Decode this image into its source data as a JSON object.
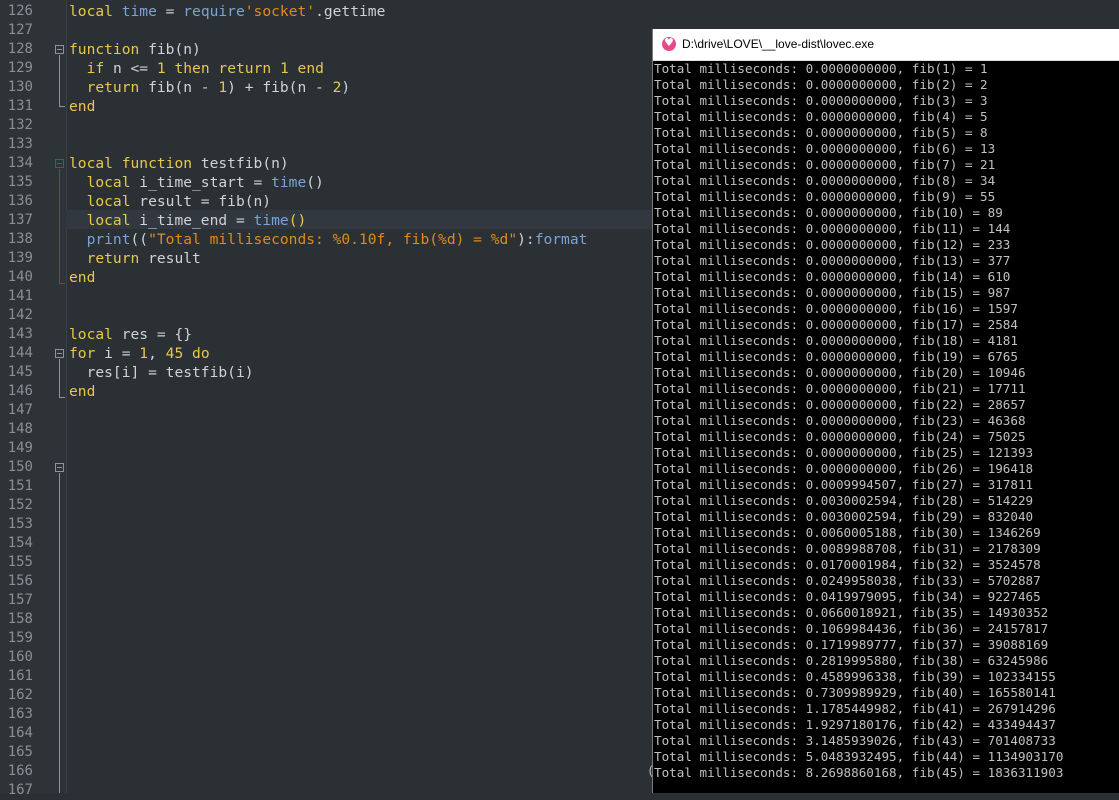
{
  "editor": {
    "line_numbers": [
      "126",
      "127",
      "128",
      "129",
      "130",
      "131",
      "132",
      "133",
      "134",
      "135",
      "136",
      "137",
      "138",
      "139",
      "140",
      "141",
      "142",
      "143",
      "144",
      "145",
      "146",
      "147",
      "148",
      "149",
      "150",
      "151",
      "152",
      "153",
      "154",
      "155",
      "156",
      "157",
      "158",
      "159",
      "160",
      "161",
      "162",
      "163",
      "164",
      "165",
      "166",
      "167"
    ],
    "lines": [
      [
        [
          "kw",
          "local"
        ],
        [
          "pl",
          " "
        ],
        [
          "bi",
          "time"
        ],
        [
          "pl",
          " = "
        ],
        [
          "bi",
          "require"
        ],
        [
          "str",
          "'socket'"
        ],
        [
          "pl",
          ".gettime"
        ]
      ],
      [],
      [
        [
          "kw",
          "function"
        ],
        [
          "pl",
          " fib(n)"
        ]
      ],
      [
        [
          "kw",
          "if"
        ],
        [
          "pl",
          " n <= "
        ],
        [
          "nm",
          "1"
        ],
        [
          "pl",
          " "
        ],
        [
          "kw",
          "then"
        ],
        [
          "pl",
          " "
        ],
        [
          "kw",
          "return"
        ],
        [
          "pl",
          " "
        ],
        [
          "nm",
          "1"
        ],
        [
          "pl",
          " "
        ],
        [
          "kw",
          "end"
        ]
      ],
      [
        [
          "kw",
          "return"
        ],
        [
          "pl",
          " fib(n - "
        ],
        [
          "nm",
          "1"
        ],
        [
          "pl",
          ") + fib(n - "
        ],
        [
          "nm",
          "2"
        ],
        [
          "pl",
          ")"
        ]
      ],
      [
        [
          "kw",
          "end"
        ]
      ],
      [],
      [],
      [
        [
          "kw",
          "local"
        ],
        [
          "pl",
          " "
        ],
        [
          "kw",
          "function"
        ],
        [
          "pl",
          " testfib(n)"
        ]
      ],
      [
        [
          "kw",
          "local"
        ],
        [
          "pl",
          " i_time_start = "
        ],
        [
          "bi",
          "time"
        ],
        [
          "pl",
          "()"
        ]
      ],
      [
        [
          "kw",
          "local"
        ],
        [
          "pl",
          " result = fib(n)"
        ]
      ],
      [
        [
          "kw",
          "local"
        ],
        [
          "pl",
          " i_time_end = "
        ],
        [
          "bi",
          "time"
        ],
        [
          "kw",
          "()"
        ]
      ],
      [
        [
          "bi",
          "print"
        ],
        [
          "pl",
          "(("
        ],
        [
          "str",
          "\"Total milliseconds: %0.10f, fib(%d) = %d\""
        ],
        [
          "pl",
          "):"
        ],
        [
          "bi",
          "format"
        ]
      ],
      [
        [
          "kw",
          "return"
        ],
        [
          "pl",
          " result"
        ]
      ],
      [
        [
          "kw",
          "end"
        ]
      ],
      [],
      [],
      [
        [
          "kw",
          "local"
        ],
        [
          "pl",
          " res = {}"
        ]
      ],
      [
        [
          "kw",
          "for"
        ],
        [
          "pl",
          " i = "
        ],
        [
          "nm",
          "1"
        ],
        [
          "pl",
          ", "
        ],
        [
          "nm",
          "45"
        ],
        [
          "pl",
          " "
        ],
        [
          "kw",
          "do"
        ]
      ],
      [
        [
          "pl",
          "res[i] = testfib(i)"
        ]
      ],
      [
        [
          "kw",
          "end"
        ]
      ]
    ]
  },
  "console": {
    "title": "D:\\drive\\LOVE\\__love-dist\\lovec.exe",
    "caret": "(",
    "output": [
      "Total milliseconds: 0.0000000000, fib(1) = 1",
      "Total milliseconds: 0.0000000000, fib(2) = 2",
      "Total milliseconds: 0.0000000000, fib(3) = 3",
      "Total milliseconds: 0.0000000000, fib(4) = 5",
      "Total milliseconds: 0.0000000000, fib(5) = 8",
      "Total milliseconds: 0.0000000000, fib(6) = 13",
      "Total milliseconds: 0.0000000000, fib(7) = 21",
      "Total milliseconds: 0.0000000000, fib(8) = 34",
      "Total milliseconds: 0.0000000000, fib(9) = 55",
      "Total milliseconds: 0.0000000000, fib(10) = 89",
      "Total milliseconds: 0.0000000000, fib(11) = 144",
      "Total milliseconds: 0.0000000000, fib(12) = 233",
      "Total milliseconds: 0.0000000000, fib(13) = 377",
      "Total milliseconds: 0.0000000000, fib(14) = 610",
      "Total milliseconds: 0.0000000000, fib(15) = 987",
      "Total milliseconds: 0.0000000000, fib(16) = 1597",
      "Total milliseconds: 0.0000000000, fib(17) = 2584",
      "Total milliseconds: 0.0000000000, fib(18) = 4181",
      "Total milliseconds: 0.0000000000, fib(19) = 6765",
      "Total milliseconds: 0.0000000000, fib(20) = 10946",
      "Total milliseconds: 0.0000000000, fib(21) = 17711",
      "Total milliseconds: 0.0000000000, fib(22) = 28657",
      "Total milliseconds: 0.0000000000, fib(23) = 46368",
      "Total milliseconds: 0.0000000000, fib(24) = 75025",
      "Total milliseconds: 0.0000000000, fib(25) = 121393",
      "Total milliseconds: 0.0000000000, fib(26) = 196418",
      "Total milliseconds: 0.0009994507, fib(27) = 317811",
      "Total milliseconds: 0.0030002594, fib(28) = 514229",
      "Total milliseconds: 0.0030002594, fib(29) = 832040",
      "Total milliseconds: 0.0060005188, fib(30) = 1346269",
      "Total milliseconds: 0.0089988708, fib(31) = 2178309",
      "Total milliseconds: 0.0170001984, fib(32) = 3524578",
      "Total milliseconds: 0.0249958038, fib(33) = 5702887",
      "Total milliseconds: 0.0419979095, fib(34) = 9227465",
      "Total milliseconds: 0.0660018921, fib(35) = 14930352",
      "Total milliseconds: 0.1069984436, fib(36) = 24157817",
      "Total milliseconds: 0.1719989777, fib(37) = 39088169",
      "Total milliseconds: 0.2819995880, fib(38) = 63245986",
      "Total milliseconds: 0.4589996338, fib(39) = 102334155",
      "Total milliseconds: 0.7309989929, fib(40) = 165580141",
      "Total milliseconds: 1.1785449982, fib(41) = 267914296",
      "Total milliseconds: 1.9297180176, fib(42) = 433494437",
      "Total milliseconds: 3.1485939026, fib(43) = 701408733",
      "Total milliseconds: 5.0483932495, fib(44) = 1134903170",
      "Total milliseconds: 8.2698860168, fib(45) = 1836311903"
    ]
  }
}
